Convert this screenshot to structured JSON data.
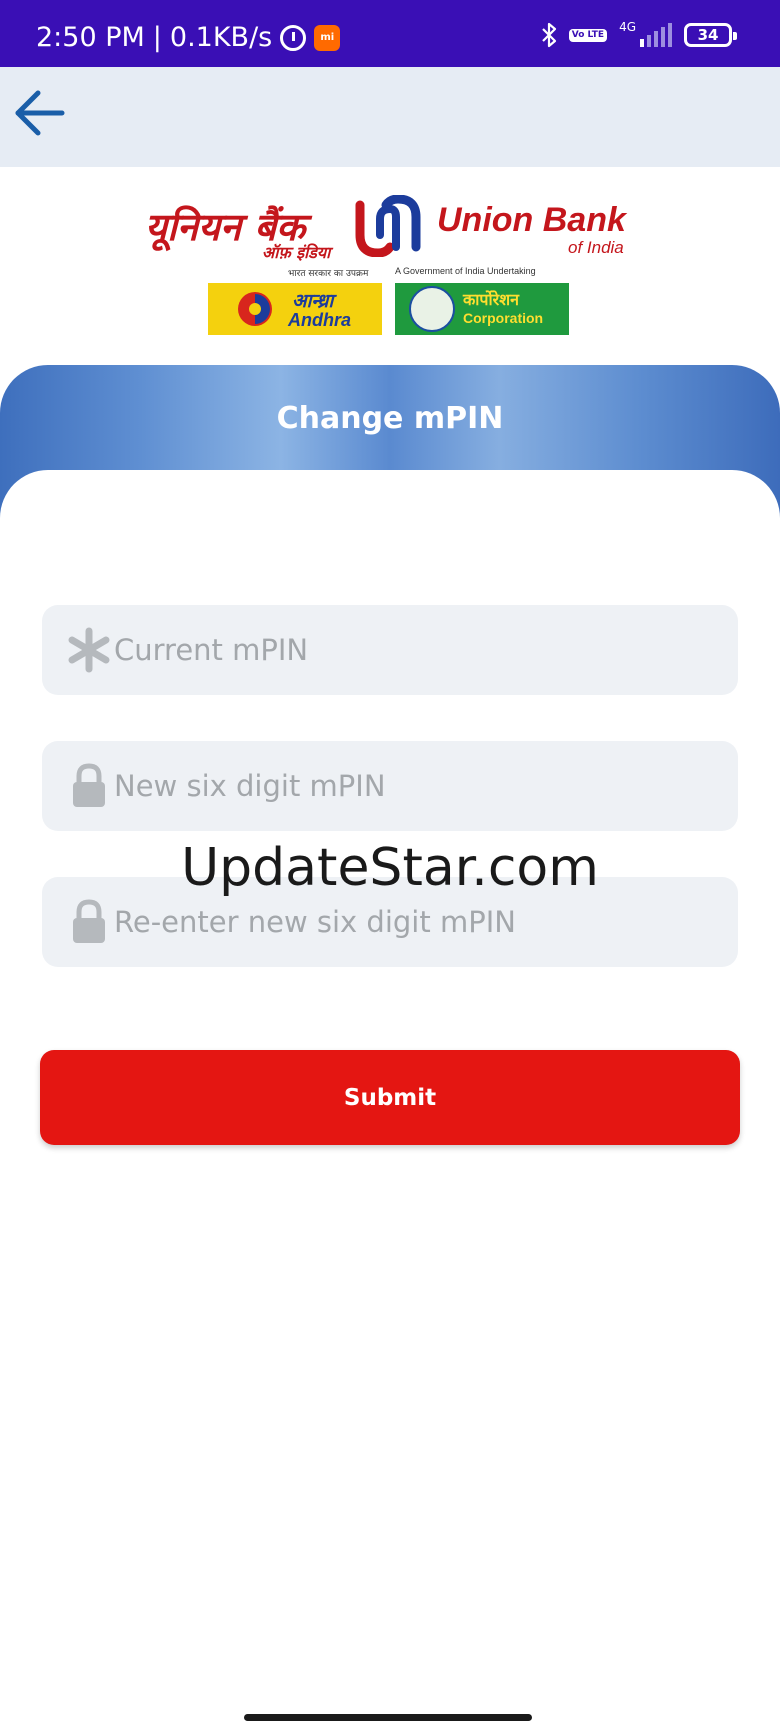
{
  "status_bar": {
    "time": "2:50 PM",
    "separator": "|",
    "speed": "0.1KB/s",
    "alarm_icon": "alarm-clock-icon",
    "notification_icon": "mi-app-icon",
    "bluetooth_icon": "bluetooth-icon",
    "volte_label": "Vo LTE",
    "network_type": "4G",
    "battery_level": "34"
  },
  "nav": {
    "back_icon": "arrow-left-icon"
  },
  "logo": {
    "hindi_name": "यूनियन बैंक",
    "hindi_sub": "ऑफ़ इंडिया",
    "english_name": "Union Bank",
    "english_sub": "of India",
    "tagline_hindi": "भारत सरकार का उपक्रम",
    "tagline_english": "A Government of India Undertaking",
    "andhra_hindi": "आन्ध्रा",
    "andhra_english": "Andhra",
    "corporation_hindi": "कार्पोरेशन",
    "corporation_english": "Corporation"
  },
  "card": {
    "title": "Change mPIN"
  },
  "form": {
    "current_mpin_placeholder": "Current mPIN",
    "new_mpin_placeholder": "New six digit mPIN",
    "reenter_mpin_placeholder": "Re-enter new six digit mPIN",
    "submit_label": "Submit"
  },
  "watermark": "UpdateStar.com",
  "colors": {
    "status_bar": "#3a0fb5",
    "brand_red": "#c4161c",
    "submit": "#e41612",
    "header_blue": "#5a8ad0",
    "back_arrow": "#1a5ea8"
  }
}
